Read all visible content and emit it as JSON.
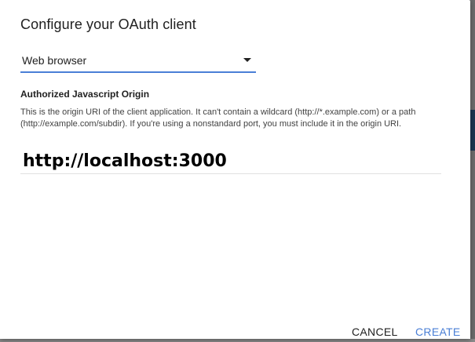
{
  "dialog": {
    "title": "Configure your OAuth client",
    "client_type": {
      "selected": "Web browser"
    },
    "origin_section": {
      "label": "Authorized Javascript Origin",
      "help_text": "This is the origin URI of the client application. It can't contain a wildcard (http://*.example.com) or a path (http://example.com/subdir). If you're using a nonstandard port, you must include it in the origin URI.",
      "input_value": "http://localhost:3000"
    },
    "actions": {
      "cancel_label": "CANCEL",
      "create_label": "CREATE"
    }
  },
  "colors": {
    "accent": "#4a7fd6",
    "text": "#212121"
  },
  "icons": {
    "dropdown": "chevron-down-icon"
  }
}
